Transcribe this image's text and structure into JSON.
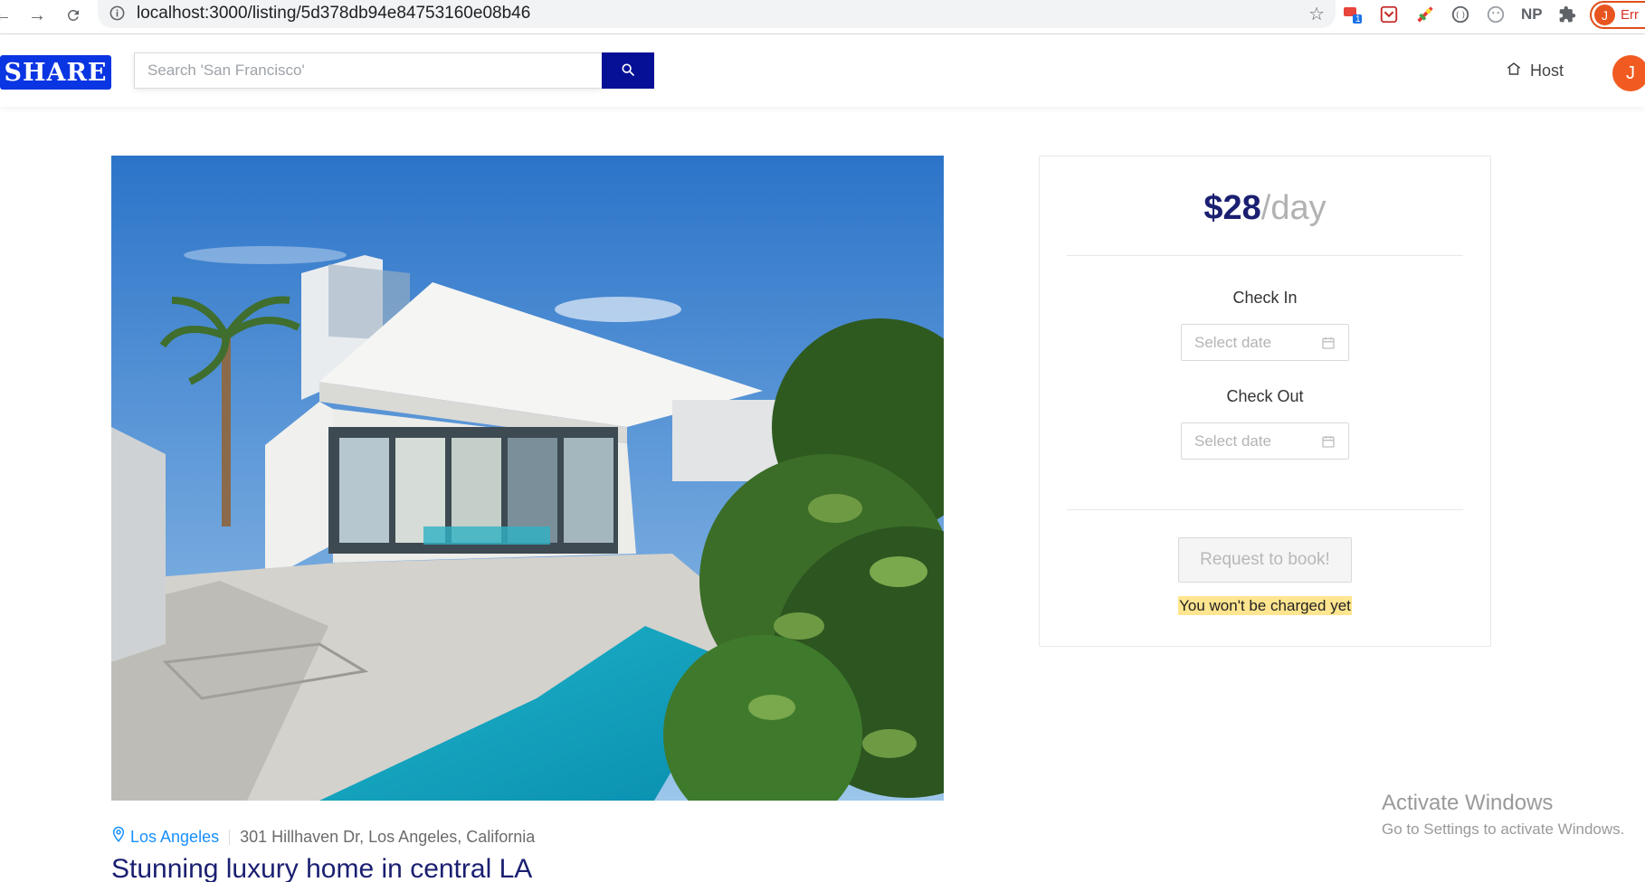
{
  "browser": {
    "url": "localhost:3000/listing/5d378db94e84753160e08b46",
    "profile_initial": "J",
    "profile_status": "Err",
    "extension_badge": "1",
    "extension_np": "NP"
  },
  "header": {
    "logo_text": "SHARE",
    "search_placeholder": "Search 'San Francisco'",
    "host_label": "Host",
    "user_initial": "J"
  },
  "listing": {
    "city": "Los Angeles",
    "address": "301 Hillhaven Dr, Los Angeles, California",
    "title": "Stunning luxury home in central LA"
  },
  "booking": {
    "price": "$28",
    "price_unit": "/day",
    "check_in_label": "Check In",
    "check_out_label": "Check Out",
    "date_placeholder": "Select date",
    "book_button": "Request to book!",
    "charge_note": "You won't be charged yet"
  },
  "watermark": {
    "title": "Activate Windows",
    "subtitle": "Go to Settings to activate Windows."
  },
  "colors": {
    "brand_blue": "#0a35e2",
    "search_button": "#061096",
    "title_navy": "#1a1f71",
    "link_blue": "#1890ff",
    "avatar_orange": "#f15b21",
    "highlight": "#ffe58f"
  }
}
